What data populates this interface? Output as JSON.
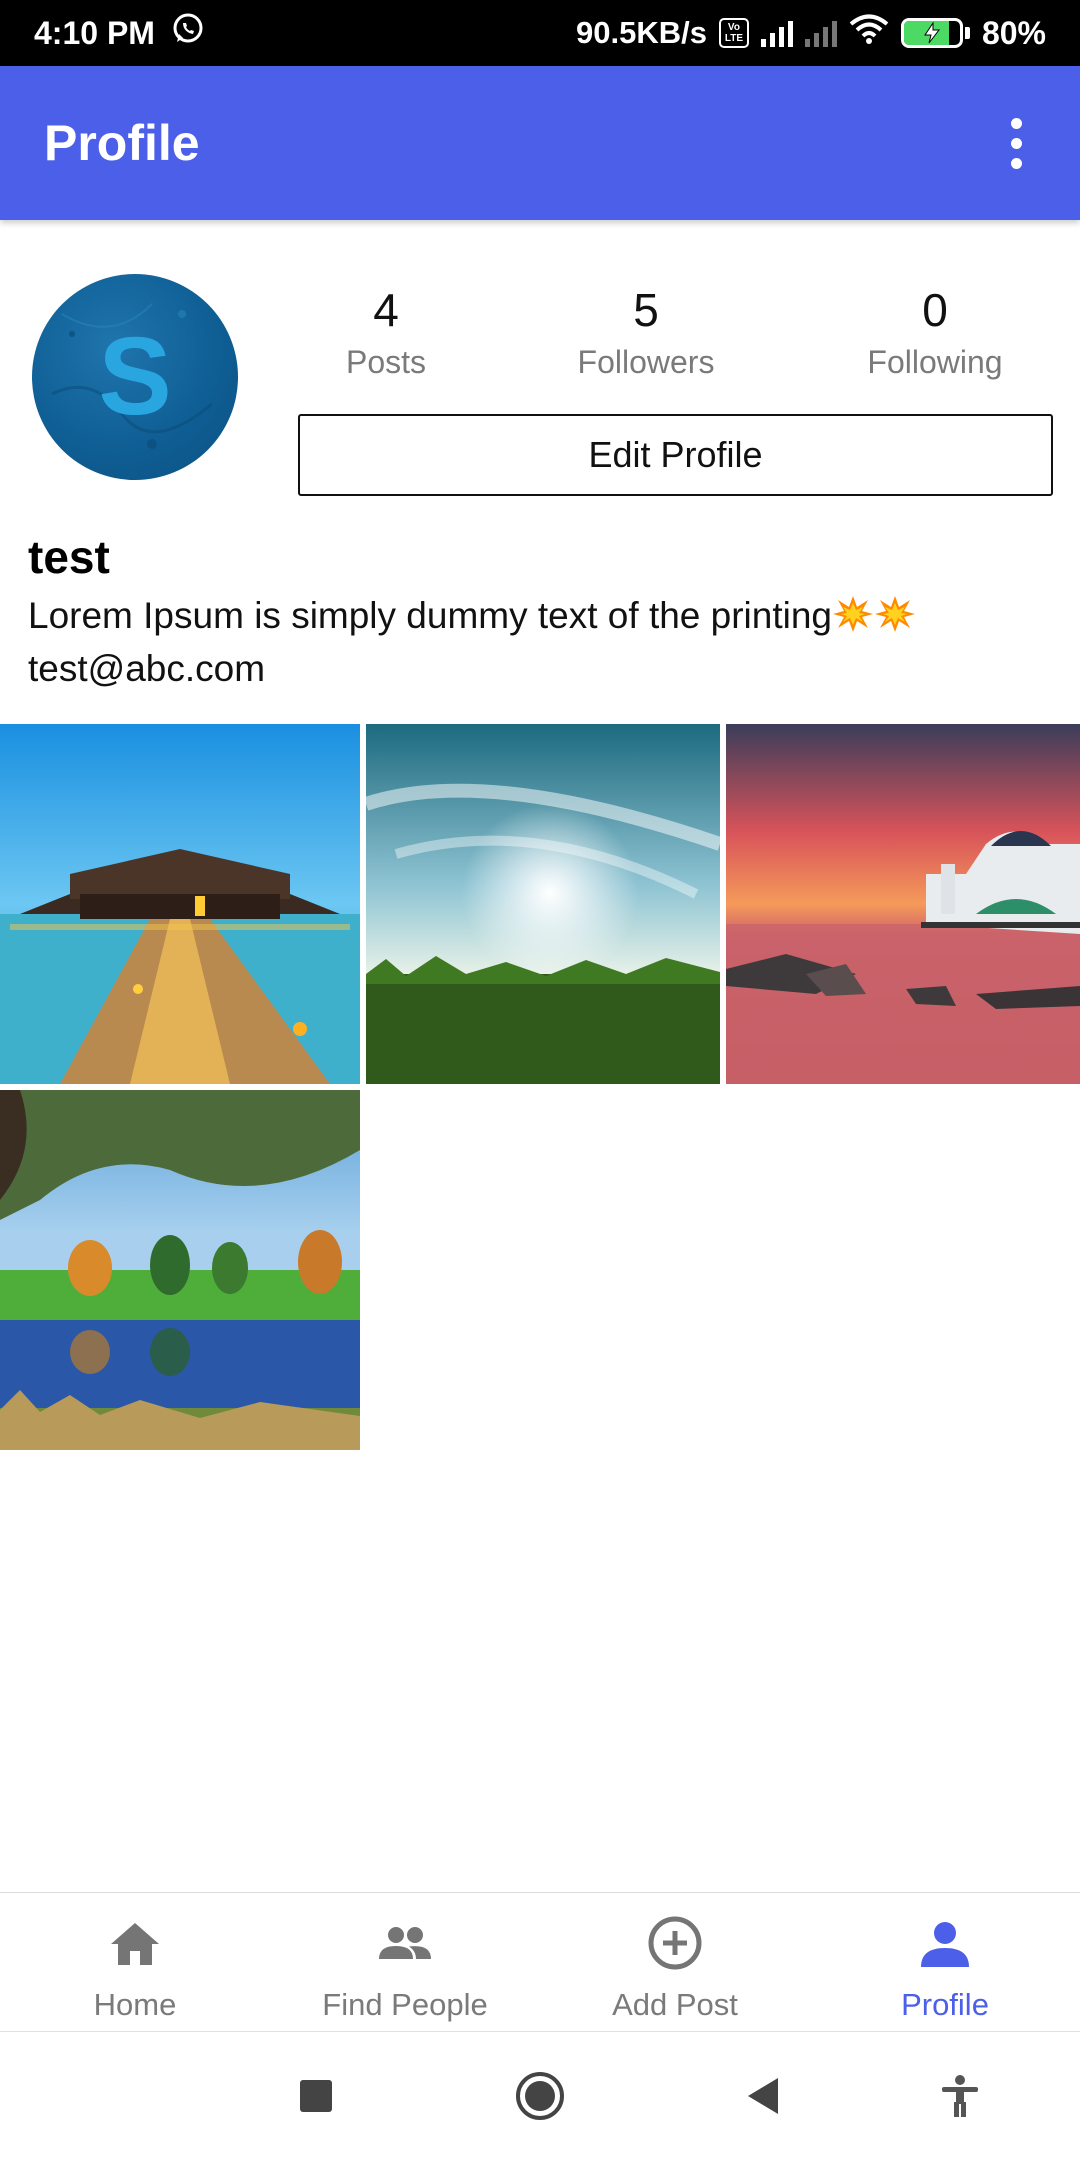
{
  "status_bar": {
    "time": "4:10 PM",
    "net_speed": "90.5KB/s",
    "volte_top": "Vo",
    "volte_bottom": "LTE",
    "battery": "80%",
    "battery_level": 0.8
  },
  "app_bar": {
    "title": "Profile"
  },
  "profile": {
    "avatar_letter": "S",
    "username": "test",
    "bio": "Lorem Ipsum is simply dummy text of the printing",
    "email": "test@abc.com",
    "edit_button": "Edit Profile",
    "stats": [
      {
        "value": "4",
        "label": "Posts"
      },
      {
        "value": "5",
        "label": "Followers"
      },
      {
        "value": "0",
        "label": "Following"
      }
    ]
  },
  "posts": [
    {
      "icon": "overwater-villa-photo"
    },
    {
      "icon": "sky-grass-sunset-photo"
    },
    {
      "icon": "mosque-sunset-sea-photo"
    },
    {
      "icon": "park-lake-reflection-photo"
    }
  ],
  "bottom_nav": {
    "items": [
      {
        "label": "Home",
        "icon": "home-icon"
      },
      {
        "label": "Find People",
        "icon": "people-icon"
      },
      {
        "label": "Add Post",
        "icon": "add-circle-icon"
      },
      {
        "label": "Profile",
        "icon": "person-icon",
        "active": true
      }
    ]
  },
  "colors": {
    "accent": "#4c5fe8",
    "inactive": "#7a7a7a"
  }
}
